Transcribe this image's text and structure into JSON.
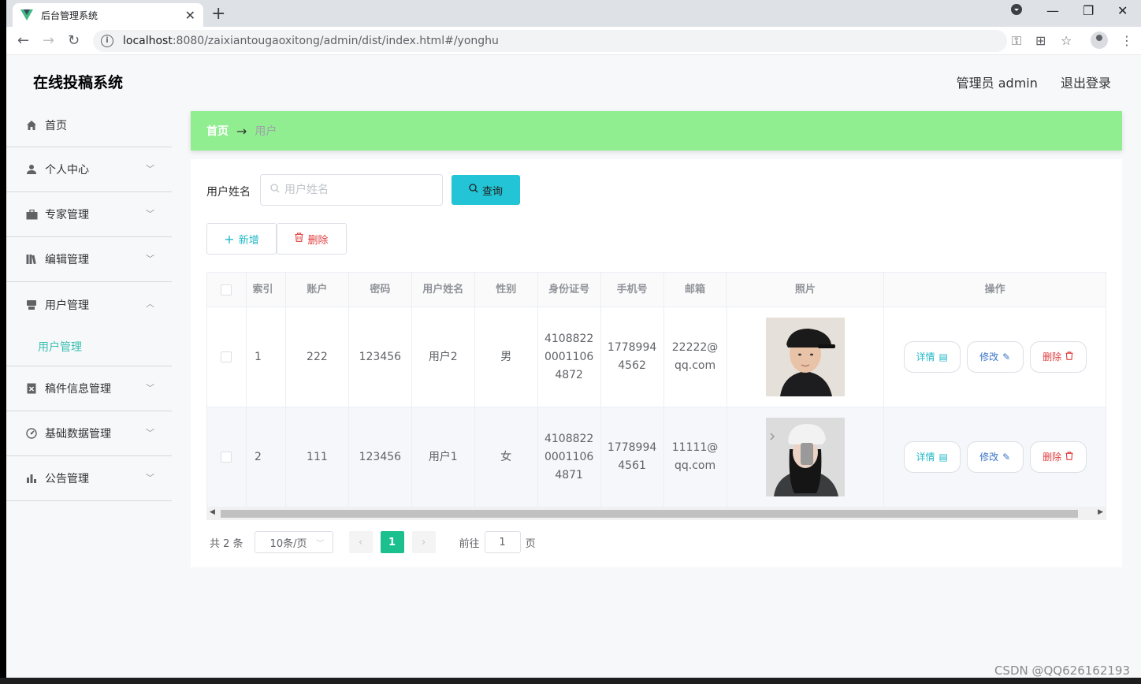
{
  "browser": {
    "tab_title": "后台管理系统",
    "url_host": "localhost",
    "url_path": ":8080/zaixiantougaoxitong/admin/dist/index.html#/yonghu"
  },
  "app": {
    "title": "在线投稿系统",
    "user_label": "管理员 admin",
    "logout_label": "退出登录"
  },
  "sidebar": {
    "items": [
      {
        "label": "首页",
        "icon": "home-icon"
      },
      {
        "label": "个人中心",
        "icon": "user-icon"
      },
      {
        "label": "专家管理",
        "icon": "briefcase-icon"
      },
      {
        "label": "编辑管理",
        "icon": "books-icon"
      },
      {
        "label": "用户管理",
        "icon": "printer-icon",
        "expanded": true,
        "children": [
          "用户管理"
        ]
      },
      {
        "label": "稿件信息管理",
        "icon": "document-x-icon"
      },
      {
        "label": "基础数据管理",
        "icon": "gauge-icon"
      },
      {
        "label": "公告管理",
        "icon": "bar-chart-icon"
      }
    ]
  },
  "breadcrumb": {
    "home": "首页",
    "separator": "→",
    "current": "用户"
  },
  "search": {
    "label": "用户姓名",
    "placeholder": "用户姓名",
    "button": "查询"
  },
  "actions": {
    "add": "新增",
    "delete": "删除"
  },
  "table": {
    "columns": [
      "",
      "索引",
      "账户",
      "密码",
      "用户姓名",
      "性别",
      "身份证号",
      "手机号",
      "邮箱",
      "照片",
      "操作"
    ],
    "rows": [
      {
        "index": "1",
        "account": "222",
        "password": "123456",
        "name": "用户2",
        "gender": "男",
        "id_number": "410882200011064872",
        "phone": "17789944562",
        "email": "22222@qq.com"
      },
      {
        "index": "2",
        "account": "111",
        "password": "123456",
        "name": "用户1",
        "gender": "女",
        "id_number": "410882200011064871",
        "phone": "17789944561",
        "email": "11111@qq.com"
      }
    ],
    "row_actions": {
      "detail": "详情",
      "edit": "修改",
      "delete": "删除"
    }
  },
  "pagination": {
    "total_text": "共 2 条",
    "page_size": "10条/页",
    "current_page": "1",
    "goto_prefix": "前往",
    "goto_value": "1",
    "goto_suffix": "页"
  },
  "watermark": "CSDN @QQ626162193",
  "colors": {
    "breadcrumb_bg": "#90ee90",
    "query_button": "#22c4d5",
    "active_page": "#1cbf8e",
    "submenu_active": "#3bbfb2"
  }
}
